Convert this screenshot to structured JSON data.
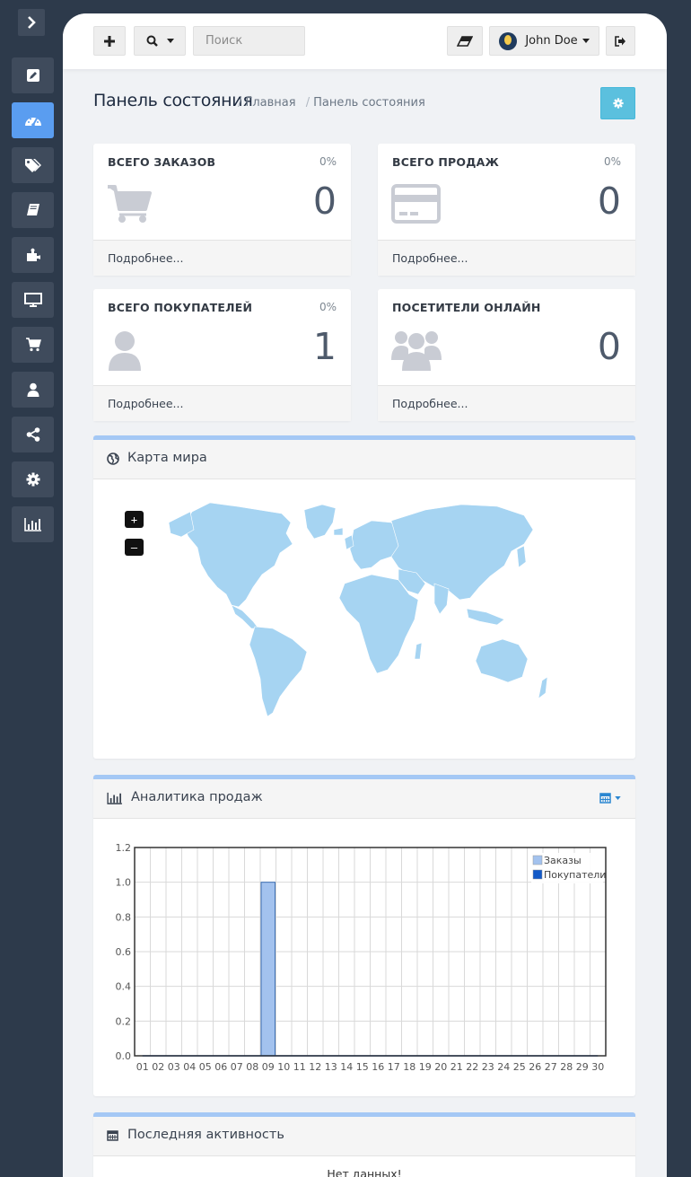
{
  "sidebar": {
    "toggle_icon": "chevron-right-icon",
    "items": [
      {
        "name": "sidebar-item-edit",
        "icon": "pencil-icon",
        "active": false
      },
      {
        "name": "sidebar-item-dashboard",
        "icon": "dashboard-icon",
        "active": true
      },
      {
        "name": "sidebar-item-catalog",
        "icon": "tags-icon",
        "active": false
      },
      {
        "name": "sidebar-item-book",
        "icon": "book-icon",
        "active": false
      },
      {
        "name": "sidebar-item-extensions",
        "icon": "puzzle-icon",
        "active": false
      },
      {
        "name": "sidebar-item-design",
        "icon": "monitor-icon",
        "active": false
      },
      {
        "name": "sidebar-item-sales",
        "icon": "cart-icon",
        "active": false
      },
      {
        "name": "sidebar-item-customers",
        "icon": "user-icon",
        "active": false
      },
      {
        "name": "sidebar-item-marketing",
        "icon": "share-icon",
        "active": false
      },
      {
        "name": "sidebar-item-system",
        "icon": "gear-icon",
        "active": false
      },
      {
        "name": "sidebar-item-reports",
        "icon": "bar-chart-icon",
        "active": false
      }
    ]
  },
  "topbar": {
    "add_icon": "plus-icon",
    "search_icon": "search-icon",
    "search_placeholder": "Поиск",
    "eraser_icon": "eraser-icon",
    "user_name": "John Doe",
    "logout_icon": "sign-out-icon"
  },
  "header": {
    "title": "Панель состояния",
    "breadcrumb": [
      "Главная",
      "Панель состояния"
    ],
    "settings_icon": "gear-icon"
  },
  "tiles": [
    {
      "title": "ВСЕГО ЗАКАЗОВ",
      "percent": "0%",
      "value": "0",
      "icon": "cart-icon",
      "link": "Подробнее..."
    },
    {
      "title": "ВСЕГО ПРОДАЖ",
      "percent": "0%",
      "value": "0",
      "icon": "credit-card-icon",
      "link": "Подробнее..."
    },
    {
      "title": "ВСЕГО ПОКУПАТЕЛЕЙ",
      "percent": "0%",
      "value": "1",
      "icon": "user-icon",
      "link": "Подробнее..."
    },
    {
      "title": "ПОСЕТИТЕЛИ ОНЛАЙН",
      "percent": "",
      "value": "0",
      "icon": "users-icon",
      "link": "Подробнее..."
    }
  ],
  "map_panel": {
    "title": "Карта мира",
    "zoom_in": "+",
    "zoom_out": "–",
    "land_color": "#a6d4f2"
  },
  "sales_panel": {
    "title": "Аналитика продаж",
    "calendar_icon": "calendar-icon"
  },
  "activity_panel": {
    "title": "Последняя активность",
    "empty": "Нет данных!"
  },
  "colors": {
    "accent": "#5a9df0",
    "sidebar_bg": "#2d3a4b",
    "info": "#5bc0de",
    "bar_orders": "#a3c2ee",
    "customers": "#1259c7"
  },
  "chart_data": {
    "type": "bar",
    "categories": [
      "01",
      "02",
      "03",
      "04",
      "05",
      "06",
      "07",
      "08",
      "09",
      "10",
      "11",
      "12",
      "13",
      "14",
      "15",
      "16",
      "17",
      "18",
      "19",
      "20",
      "21",
      "22",
      "23",
      "24",
      "25",
      "26",
      "27",
      "28",
      "29",
      "30"
    ],
    "series": [
      {
        "name": "Заказы",
        "values": [
          0,
          0,
          0,
          0,
          0,
          0,
          0,
          0,
          1,
          0,
          0,
          0,
          0,
          0,
          0,
          0,
          0,
          0,
          0,
          0,
          0,
          0,
          0,
          0,
          0,
          0,
          0,
          0,
          0,
          0
        ]
      },
      {
        "name": "Покупатели",
        "values": [
          0,
          0,
          0,
          0,
          0,
          0,
          0,
          0,
          0,
          0,
          0,
          0,
          0,
          0,
          0,
          0,
          0,
          0,
          0,
          0,
          0,
          0,
          0,
          0,
          0,
          0,
          0,
          0,
          0,
          0
        ]
      }
    ],
    "ylim": [
      0,
      1.2
    ],
    "yticks": [
      "0.0",
      "0.2",
      "0.4",
      "0.6",
      "0.8",
      "1.0",
      "1.2"
    ],
    "grid": true,
    "legend": "top-right"
  }
}
